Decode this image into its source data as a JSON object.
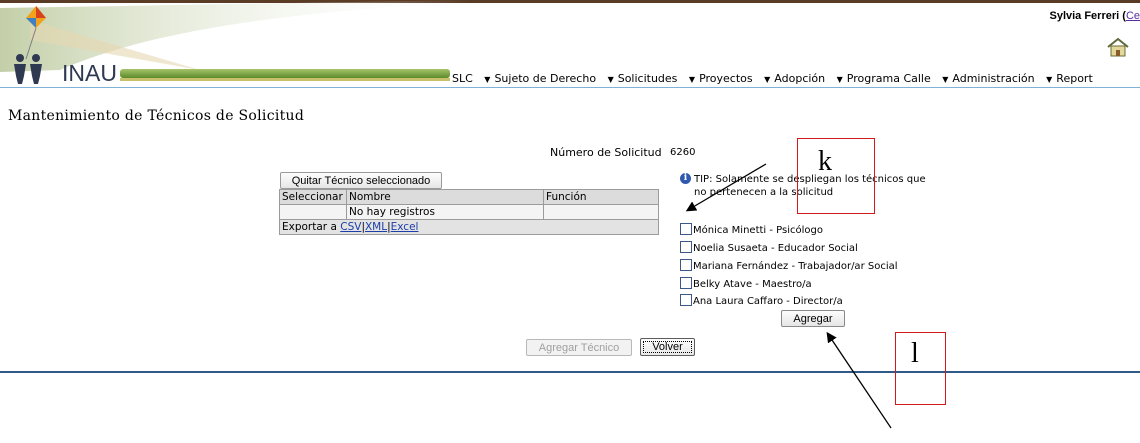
{
  "header": {
    "logo_text": "INAU",
    "user_name": "Sylvia Ferreri",
    "user_paren": "(",
    "user_link": "Ce"
  },
  "menu": {
    "items": [
      {
        "label": "SLC"
      },
      {
        "label": "Sujeto de Derecho"
      },
      {
        "label": "Solicitudes"
      },
      {
        "label": "Proyectos"
      },
      {
        "label": "Adopción"
      },
      {
        "label": "Programa Calle"
      },
      {
        "label": "Administración"
      },
      {
        "label": "Report"
      }
    ]
  },
  "page": {
    "title": "Mantenimiento de Técnicos de Solicitud",
    "numero_label": "Número de Solicitud",
    "numero_value": "6260"
  },
  "grid": {
    "quitar_button": "Quitar Técnico seleccionado",
    "columns": [
      "Seleccionar",
      "Nombre",
      "Función"
    ],
    "empty_text": "No hay registros",
    "export_label": "Exportar a",
    "export_csv": "CSV",
    "export_sep1": "|",
    "export_xml": "XML",
    "export_sep2": "|",
    "export_excel": "Excel"
  },
  "tip": {
    "text": "TIP: Solamente se despliegan los técnicos que no pertenecen a la solicitud"
  },
  "technicians": [
    {
      "label": "Mónica Minetti - Psicólogo",
      "checked": false
    },
    {
      "label": "Noelia Susaeta - Educador Social",
      "checked": false
    },
    {
      "label": "Mariana Fernández - Trabajador/ar Social",
      "checked": false
    },
    {
      "label": "Belky Atave - Maestro/a",
      "checked": false
    },
    {
      "label": "Ana Laura Caffaro - Director/a",
      "checked": false
    }
  ],
  "buttons": {
    "agregar": "Agregar",
    "agregar_tecnico": "Agregar Técnico",
    "volver": "Volver"
  },
  "annotations": {
    "k": "k",
    "l": "l"
  },
  "colors": {
    "accent_rule": "#7fb2d6",
    "footer_rule": "#2f5a87",
    "annotation": "#d21a1a"
  }
}
